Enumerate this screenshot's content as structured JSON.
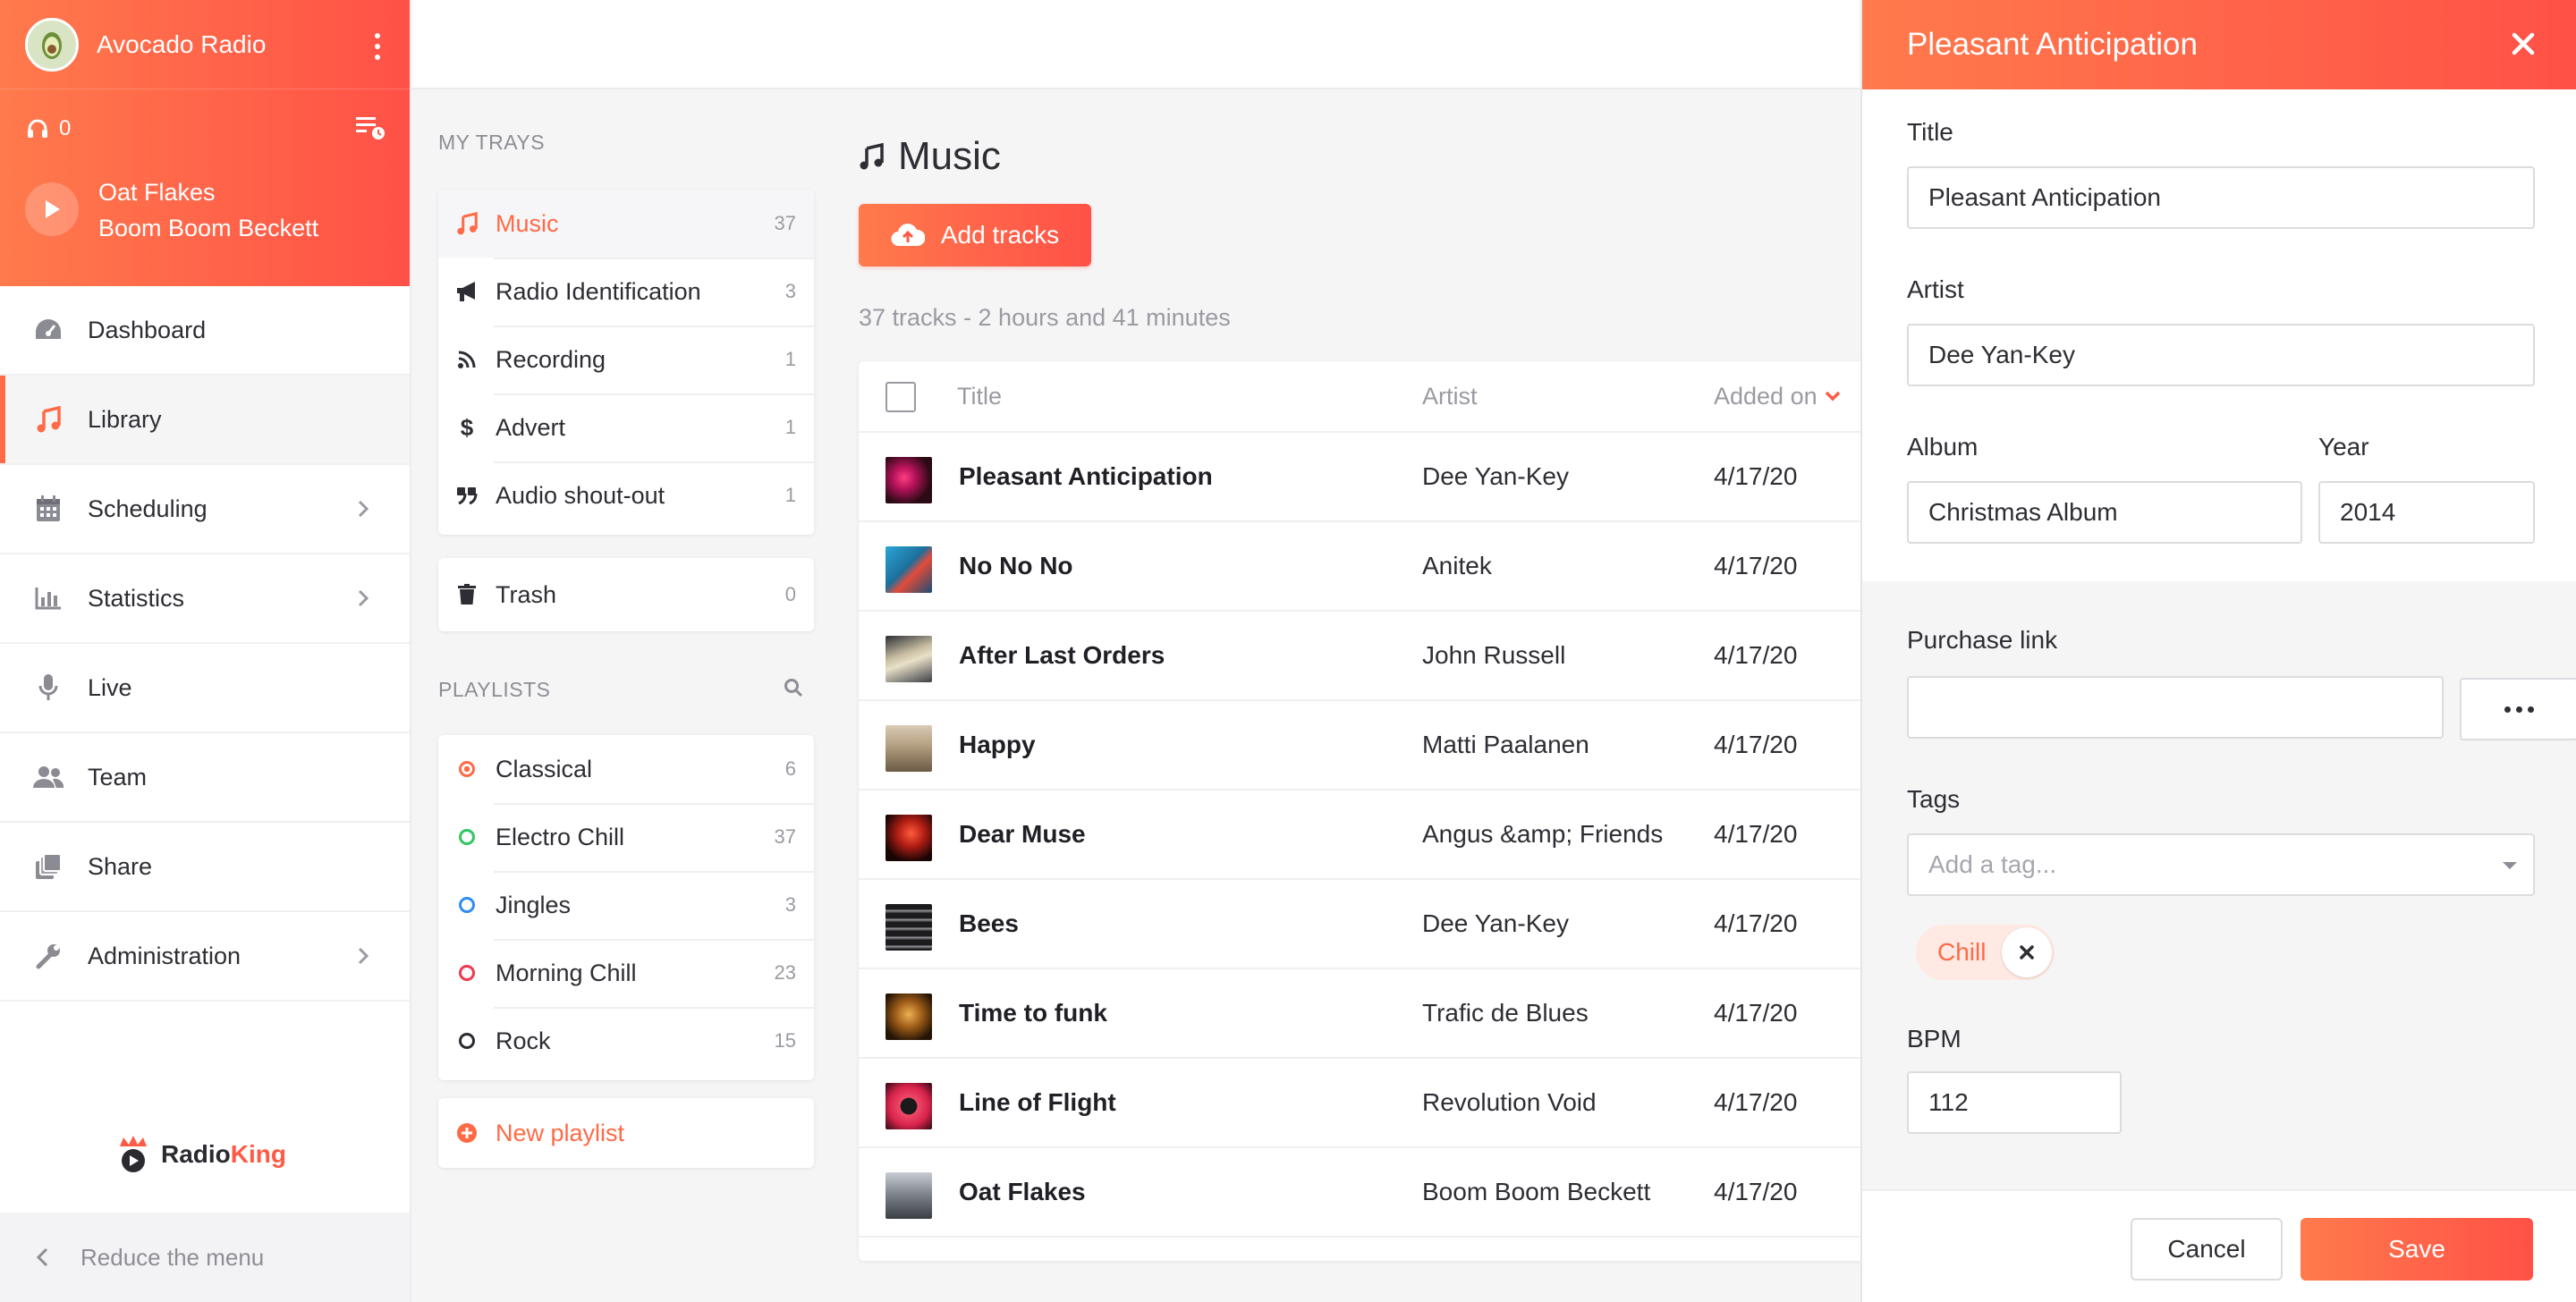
{
  "station": {
    "name": "Avocado Radio",
    "listeners": "0"
  },
  "now_playing": {
    "title": "Oat Flakes",
    "artist": "Boom Boom Beckett"
  },
  "nav": {
    "items": [
      {
        "label": "Dashboard",
        "icon": "dashboard-icon"
      },
      {
        "label": "Library",
        "icon": "music-note-icon",
        "active": true
      },
      {
        "label": "Scheduling",
        "icon": "calendar-icon"
      },
      {
        "label": "Statistics",
        "icon": "bar-chart-icon"
      },
      {
        "label": "Live",
        "icon": "microphone-icon"
      },
      {
        "label": "Team",
        "icon": "users-icon"
      },
      {
        "label": "Share",
        "icon": "share-icon"
      },
      {
        "label": "Administration",
        "icon": "wrench-icon"
      }
    ],
    "reduce_label": "Reduce the menu",
    "brand_logo": "RadioKing"
  },
  "trays": {
    "section_label": "MY TRAYS",
    "items": [
      {
        "label": "Music",
        "count": "37",
        "icon": "music-note-icon"
      },
      {
        "label": "Radio Identification",
        "count": "3",
        "icon": "megaphone-icon"
      },
      {
        "label": "Recording",
        "count": "1",
        "icon": "rss-icon"
      },
      {
        "label": "Advert",
        "count": "1",
        "icon": "dollar-icon"
      },
      {
        "label": "Audio shout-out",
        "count": "1",
        "icon": "quote-icon"
      }
    ],
    "trash": {
      "label": "Trash",
      "count": "0"
    }
  },
  "playlists": {
    "section_label": "PLAYLISTS",
    "items": [
      {
        "label": "Classical",
        "count": "6",
        "color": "#ff6a47"
      },
      {
        "label": "Electro Chill",
        "count": "37",
        "color": "#2ec760"
      },
      {
        "label": "Jingles",
        "count": "3",
        "color": "#2f8cf0"
      },
      {
        "label": "Morning Chill",
        "count": "23",
        "color": "#f0394f"
      },
      {
        "label": "Rock",
        "count": "15",
        "color": "#2a2a30"
      }
    ],
    "new_label": "New playlist"
  },
  "music": {
    "title": "Music",
    "add_button": "Add tracks",
    "summary": "37 tracks - 2 hours and 41 minutes",
    "columns": {
      "title": "Title",
      "artist": "Artist",
      "added": "Added on"
    },
    "tracks": [
      {
        "title": "Pleasant Anticipation",
        "artist": "Dee Yan-Key",
        "added": "4/17/20"
      },
      {
        "title": "No No No",
        "artist": "Anitek",
        "added": "4/17/20"
      },
      {
        "title": "After Last Orders",
        "artist": "John Russell",
        "added": "4/17/20"
      },
      {
        "title": "Happy",
        "artist": "Matti Paalanen",
        "added": "4/17/20"
      },
      {
        "title": "Dear Muse",
        "artist": "Angus &amp; Friends",
        "added": "4/17/20"
      },
      {
        "title": "Bees",
        "artist": "Dee Yan-Key",
        "added": "4/17/20"
      },
      {
        "title": "Time to funk",
        "artist": "Trafic de Blues",
        "added": "4/17/20"
      },
      {
        "title": "Line of Flight",
        "artist": "Revolution Void",
        "added": "4/17/20"
      },
      {
        "title": "Oat Flakes",
        "artist": "Boom Boom Beckett",
        "added": "4/17/20"
      }
    ]
  },
  "edit_panel": {
    "heading": "Pleasant Anticipation",
    "title_label": "Title",
    "title_value": "Pleasant Anticipation",
    "artist_label": "Artist",
    "artist_value": "Dee Yan-Key",
    "album_label": "Album",
    "album_value": "Christmas Album",
    "year_label": "Year",
    "year_value": "2014",
    "purchase_label": "Purchase link",
    "purchase_value": "",
    "tags_label": "Tags",
    "tags_placeholder": "Add a tag...",
    "tags": [
      "Chill"
    ],
    "bpm_label": "BPM",
    "bpm_value": "112",
    "cancel": "Cancel",
    "save": "Save"
  },
  "colors": {
    "accent": "#ff5a47",
    "accent_light": "#ff7a4c"
  }
}
